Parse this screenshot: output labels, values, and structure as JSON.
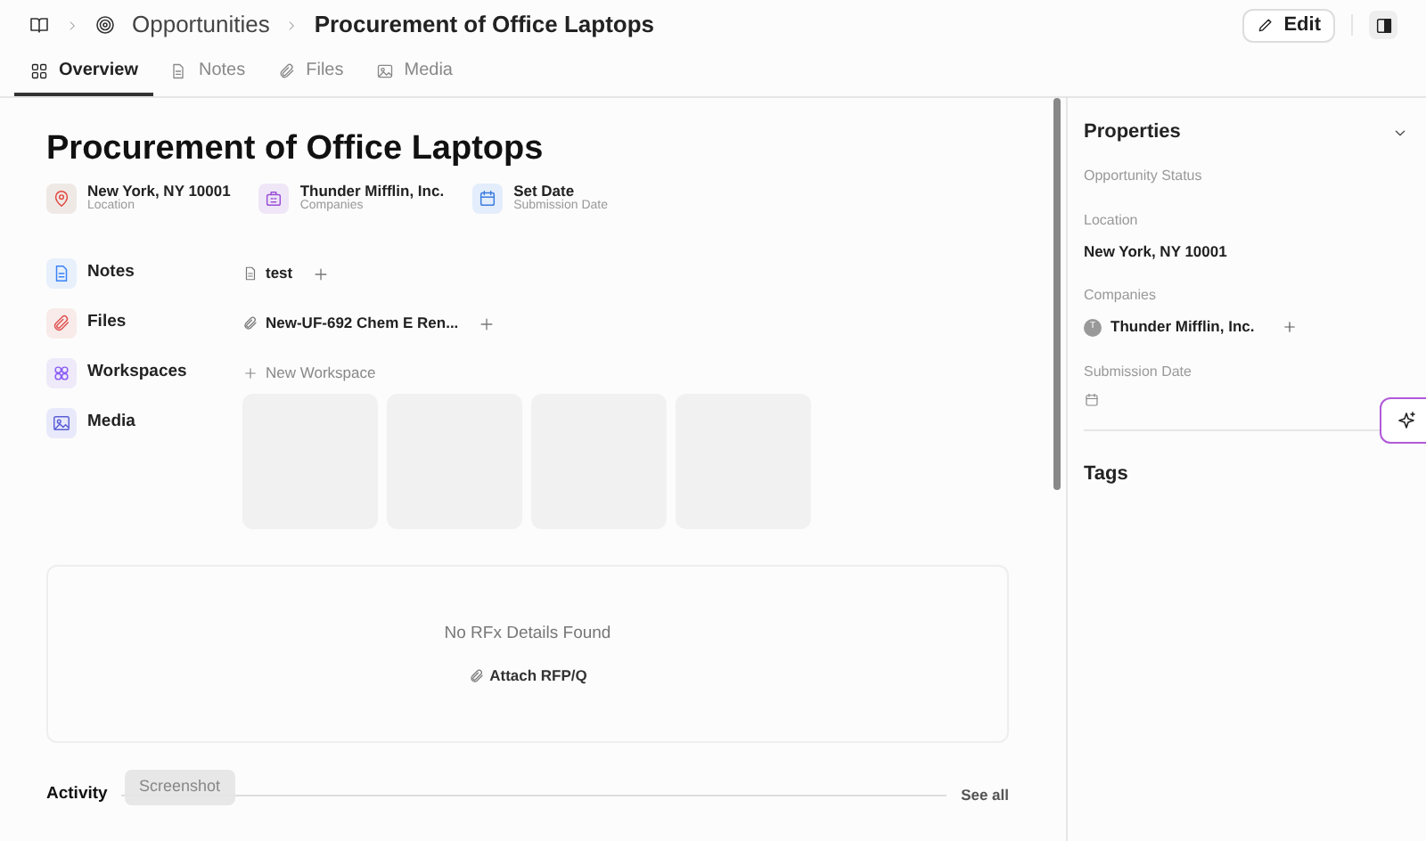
{
  "breadcrumb": [
    {
      "label": "Opportunities"
    },
    {
      "label": "Procurement of Office Laptops"
    }
  ],
  "edit_button": "Edit",
  "tabs": [
    {
      "label": "Overview",
      "selected": true,
      "kind": "grid"
    },
    {
      "label": "Notes",
      "selected": false,
      "kind": "note"
    },
    {
      "label": "Files",
      "selected": false,
      "kind": "clip"
    },
    {
      "label": "Media",
      "selected": false,
      "kind": "image"
    }
  ],
  "title": "Procurement of Office Laptops",
  "summary": [
    {
      "kind": "pin",
      "value": "New York, NY 10001",
      "label": "Location"
    },
    {
      "kind": "building",
      "value": "Thunder Mifflin, Inc.",
      "label": "Companies"
    },
    {
      "kind": "calendar",
      "value": "Set Date",
      "label": "Submission Date"
    }
  ],
  "sections": [
    {
      "kind": "note",
      "label": "Notes",
      "item": "test"
    },
    {
      "kind": "clip",
      "label": "Files",
      "item": "New-UF-692 Chem E Ren..."
    },
    {
      "kind": "workspace",
      "label": "Workspaces",
      "new_label": "New Workspace"
    },
    {
      "kind": "image",
      "label": "Media"
    }
  ],
  "rfx": {
    "message": "No RFx Details Found",
    "action": "Attach RFP/Q"
  },
  "activity": {
    "title": "Activity",
    "see_all": "See all"
  },
  "tooltip": "Screenshot",
  "properties": {
    "title": "Properties",
    "expanded": true,
    "fields": [
      {
        "label": "Opportunity Status"
      },
      {
        "label": "Location",
        "value": "New York, NY 10001"
      },
      {
        "label": "Companies",
        "value": "Thunder Mifflin, Inc.",
        "avatar": "T"
      },
      {
        "label": "Submission Date",
        "kind": "date"
      }
    ]
  },
  "tags": {
    "title": "Tags"
  }
}
